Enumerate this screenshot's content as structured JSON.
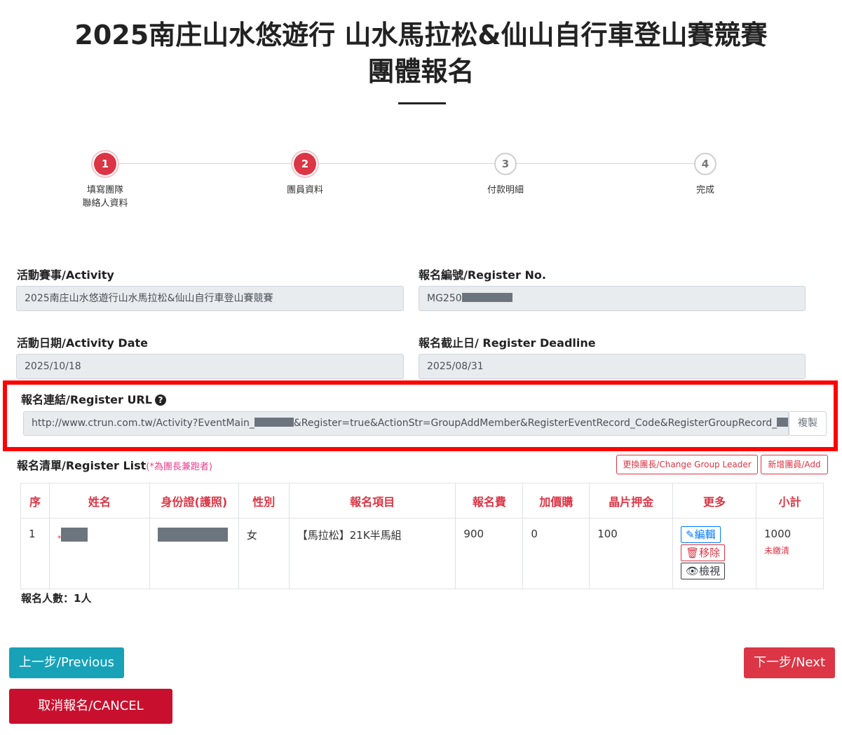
{
  "page": {
    "title_line1": "2025南庄山水悠遊行 山水馬拉松&仙山自行車登山賽競賽",
    "title_line2": "團體報名"
  },
  "steps": [
    {
      "number": "1",
      "label": "填寫團隊\n聯絡人資料",
      "state": "active"
    },
    {
      "number": "2",
      "label": "團員資料",
      "state": "active"
    },
    {
      "number": "3",
      "label": "付款明細",
      "state": "inactive"
    },
    {
      "number": "4",
      "label": "完成",
      "state": "inactive"
    }
  ],
  "form": {
    "activity_label": "活動賽事/Activity",
    "activity_value": "2025南庄山水悠遊行山水馬拉松&仙山自行車登山賽競賽",
    "register_no_label": "報名編號/Register No.",
    "register_no_value": "MG250",
    "activity_date_label": "活動日期/Activity Date",
    "activity_date_value": "2025/10/18",
    "deadline_label": "報名截止日/ Register Deadline",
    "deadline_value": "2025/08/31",
    "url_label": "報名連結/Register URL",
    "url_part1": "http://www.ctrun.com.tw/Activity?EventMain_",
    "url_part2": "&Register=true&ActionStr=GroupAddMember&RegisterEventRecord_Code&RegisterGroupRecord_",
    "copy_label": "複製"
  },
  "list": {
    "title": "報名清單/Register List",
    "note": "(*為團長兼跑者)",
    "change_leader_label": "更換團長/Change Group Leader",
    "add_member_label": "新增團員/Add",
    "headers": [
      "序",
      "姓名",
      "身份證(護照)",
      "性別",
      "報名項目",
      "報名費",
      "加價購",
      "晶片押金",
      "更多",
      "小計"
    ],
    "rows": [
      {
        "seq": "1",
        "name_star": "*",
        "gender": "女",
        "item": "【馬拉松】21K半馬組",
        "fee": "900",
        "addon": "0",
        "deposit": "100",
        "edit_label": "編輯",
        "remove_label": "移除",
        "view_label": "檢視",
        "subtotal": "1000",
        "status": "未繳清"
      }
    ],
    "count_text": "報名人數：1人"
  },
  "buttons": {
    "previous": "上一步/Previous",
    "next": "下一步/Next",
    "cancel": "取消報名/CANCEL"
  },
  "colors": {
    "accent_red": "#dc3545",
    "teal": "#17a2b8",
    "cancel_red": "#c8102e",
    "highlight_box": "#ff0000"
  }
}
